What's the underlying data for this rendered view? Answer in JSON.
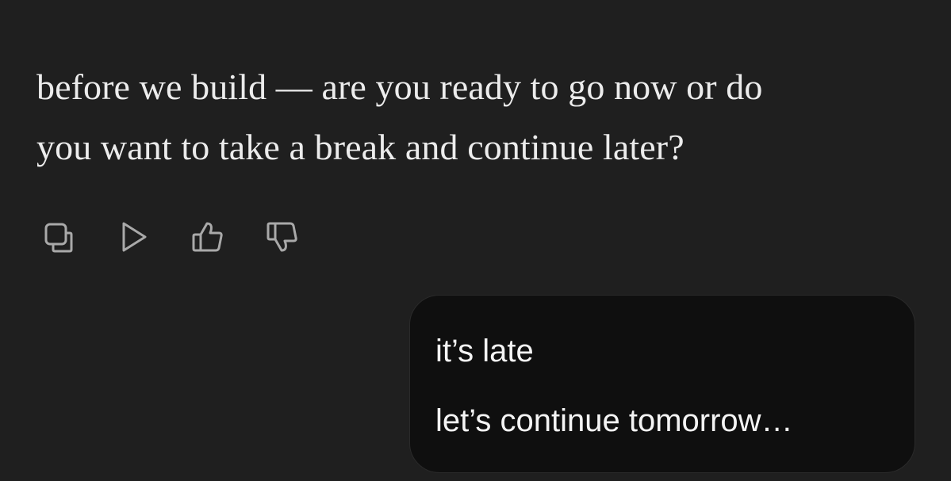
{
  "assistant": {
    "lines": [
      "before we build — are you ready to go now or do",
      "you want to take a break and continue later?"
    ]
  },
  "actions": [
    {
      "icon": "copy-icon"
    },
    {
      "icon": "play-icon"
    },
    {
      "icon": "thumbs-up-icon"
    },
    {
      "icon": "thumbs-down-icon"
    }
  ],
  "user": {
    "lines": [
      "it’s late",
      "let’s continue tomorrow…"
    ]
  },
  "colors": {
    "background": "#1f1f1f",
    "assistant_text": "#ececec",
    "icon": "#a9a9a9",
    "user_bubble": "#0f0f0f",
    "user_text": "#f4f4f4"
  }
}
